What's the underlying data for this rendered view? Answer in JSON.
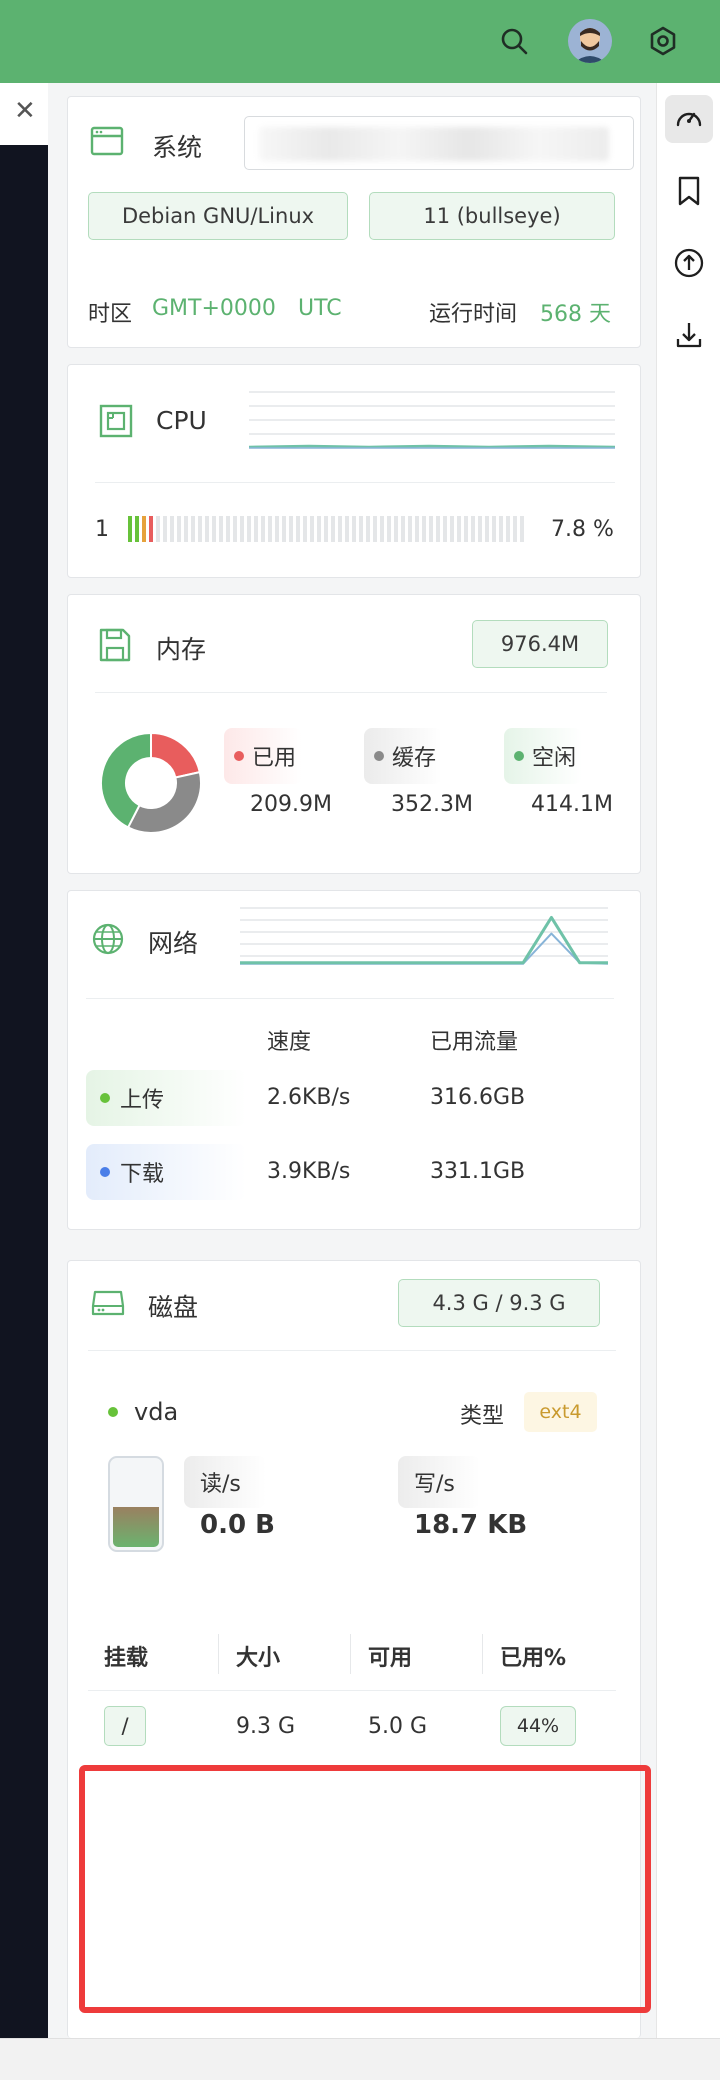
{
  "colors": {
    "brand_green": "#5cb270",
    "used_red": "#e85d5d",
    "cache_gray": "#8a8a8a",
    "free_green": "#5cb270",
    "upload_green": "#67c23a",
    "download_blue": "#4a7ee8",
    "type_amber": "#c99a2e"
  },
  "topbar": {
    "icons": [
      "search-icon",
      "avatar",
      "settings-icon"
    ]
  },
  "rail": {
    "icons": [
      "dashboard-icon",
      "bookmark-icon",
      "upload-icon",
      "download-icon"
    ]
  },
  "system": {
    "title": "系统",
    "os_name": "Debian GNU/Linux",
    "os_version": "11 (bullseye)",
    "timezone_label": "时区",
    "timezone_value": "GMT+0000",
    "timezone_name": "UTC",
    "uptime_label": "运行时间",
    "uptime_value": "568 天"
  },
  "cpu": {
    "title": "CPU",
    "cores": [
      {
        "index": "1",
        "usage_text": "7.8 %",
        "usage_fraction": 0.078
      }
    ]
  },
  "memory": {
    "title": "内存",
    "total": "976.4M",
    "legend": [
      {
        "label": "已用",
        "value": "209.9M"
      },
      {
        "label": "缓存",
        "value": "352.3M"
      },
      {
        "label": "空闲",
        "value": "414.1M"
      }
    ],
    "chart_data": {
      "type": "pie",
      "categories": [
        "已用",
        "缓存",
        "空闲"
      ],
      "values": [
        209.9,
        352.3,
        414.1
      ],
      "colors": [
        "#e85d5d",
        "#8a8a8a",
        "#5cb270"
      ]
    }
  },
  "network": {
    "title": "网络",
    "col_speed": "速度",
    "col_traffic": "已用流量",
    "rows": [
      {
        "label": "上传",
        "speed": "2.6KB/s",
        "traffic": "316.6GB"
      },
      {
        "label": "下载",
        "speed": "3.9KB/s",
        "traffic": "331.1GB"
      }
    ],
    "chart_data": {
      "type": "line",
      "x": [
        1,
        2,
        3,
        4,
        5,
        6,
        7,
        8,
        9,
        10,
        11,
        12,
        13,
        14
      ],
      "series": [
        {
          "values": [
            2,
            2,
            2,
            2,
            2,
            2,
            2,
            2,
            2,
            2,
            2,
            30,
            3,
            2
          ]
        },
        {
          "values": [
            3,
            3,
            3,
            3,
            3,
            3,
            3,
            3,
            3,
            3,
            3,
            45,
            3,
            3
          ]
        }
      ]
    }
  },
  "disk": {
    "title": "磁盘",
    "usage": "4.3 G / 9.3 G",
    "device": "vda",
    "type_label": "类型",
    "type_value": "ext4",
    "fill_fraction": 0.44,
    "read_label": "读/s",
    "read_value": "0.0 B",
    "write_label": "写/s",
    "write_value": "18.7 KB",
    "headers": {
      "mount": "挂载",
      "size": "大小",
      "avail": "可用",
      "used": "已用%"
    },
    "rows": [
      {
        "mount": "/",
        "size": "9.3 G",
        "avail": "5.0 G",
        "used": "44%"
      }
    ]
  }
}
